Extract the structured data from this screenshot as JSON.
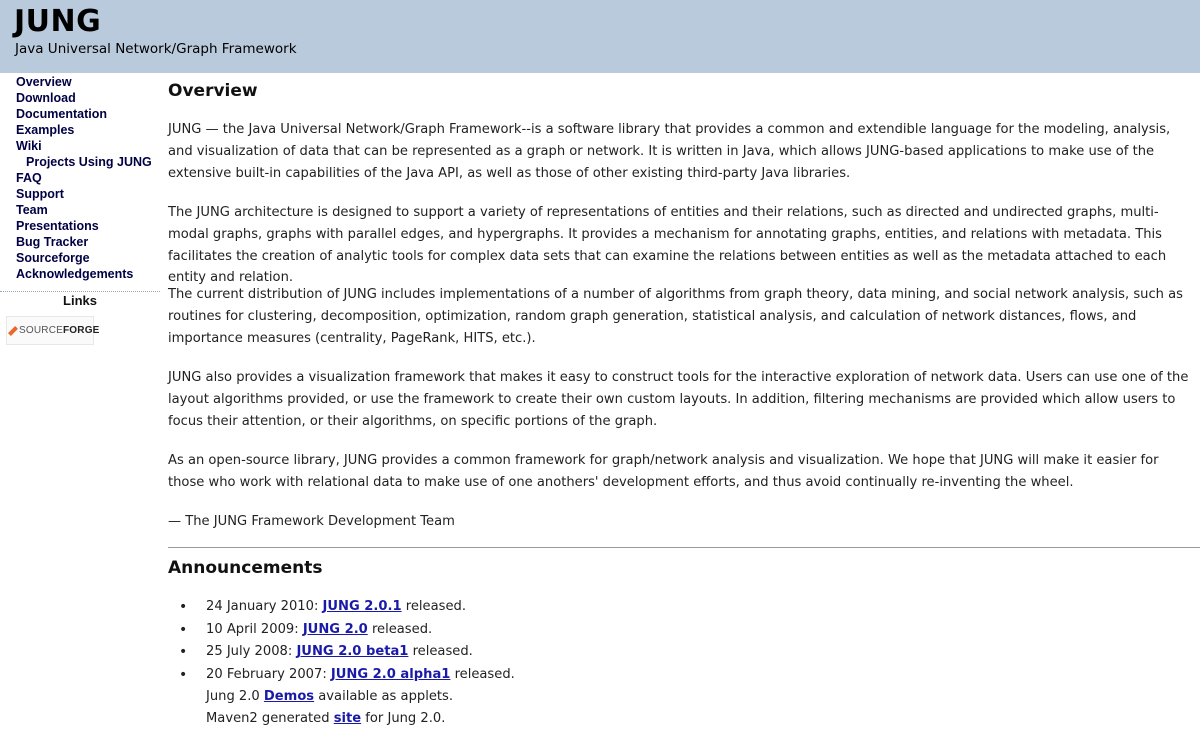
{
  "header": {
    "title": "JUNG",
    "subtitle": "Java Universal Network/Graph Framework"
  },
  "sidebar": {
    "items": [
      {
        "label": "Overview"
      },
      {
        "label": "Download"
      },
      {
        "label": "Documentation"
      },
      {
        "label": "Examples"
      },
      {
        "label": "Wiki"
      },
      {
        "label": "Projects Using JUNG"
      },
      {
        "label": "FAQ"
      },
      {
        "label": "Support"
      },
      {
        "label": "Team"
      },
      {
        "label": "Presentations"
      },
      {
        "label": "Bug Tracker"
      },
      {
        "label": "Sourceforge"
      },
      {
        "label": "Acknowledgements"
      }
    ],
    "links_title": "Links",
    "badge": {
      "source": "SOURCE",
      "forge": "FORGE",
      "accent": "#e8692b"
    }
  },
  "main": {
    "overview_title": "Overview",
    "paragraphs": [
      "JUNG — the Java Universal Network/Graph Framework--is a software library that provides a common and extendible language for the modeling, analysis, and visualization of data that can be represented as a graph or network. It is written in Java, which allows JUNG-based applications to make use of the extensive built-in capabilities of the Java API, as well as those of other existing third-party Java libraries.",
      "The JUNG architecture is designed to support a variety of representations of entities and their relations, such as directed and undirected graphs, multi-modal graphs, graphs with parallel edges, and hypergraphs. It provides a mechanism for annotating graphs, entities, and relations with metadata. This facilitates the creation of analytic tools for complex data sets that can examine the relations between entities as well as the metadata attached to each entity and relation.",
      "The current distribution of JUNG includes implementations of a number of algorithms from graph theory, data mining, and social network analysis, such as routines for clustering, decomposition, optimization, random graph generation, statistical analysis, and calculation of network distances, flows, and importance measures (centrality, PageRank, HITS, etc.).",
      "JUNG also provides a visualization framework that makes it easy to construct tools for the interactive exploration of network data. Users can use one of the layout algorithms provided, or use the framework to create their own custom layouts. In addition, filtering mechanisms are provided which allow users to focus their attention, or their algorithms, on specific portions of the graph.",
      "As an open-source library, JUNG provides a common framework for graph/network analysis and visualization. We hope that JUNG will make it easier for those who work with relational data to make use of one anothers' development efforts, and thus avoid continually re-inventing the wheel."
    ],
    "signature": "— The JUNG Framework Development Team",
    "announcements_title": "Announcements",
    "announcements": [
      {
        "date": "24 January 2010: ",
        "link": "JUNG 2.0.1",
        "suffix": " released."
      },
      {
        "date": "10 April 2009: ",
        "link": "JUNG 2.0",
        "suffix": " released."
      },
      {
        "date": "25 July 2008: ",
        "link": "JUNG 2.0 beta1",
        "suffix": " released."
      },
      {
        "date": "20 February 2007: ",
        "link": "JUNG 2.0 alpha1",
        "suffix": " released."
      }
    ],
    "extras": [
      {
        "prefix": "Jung 2.0 ",
        "link": "Demos",
        "suffix": " available as applets."
      },
      {
        "prefix": "Maven2 generated ",
        "link": "site",
        "suffix": " for Jung 2.0."
      }
    ],
    "link_color": "#1a1aa8"
  }
}
